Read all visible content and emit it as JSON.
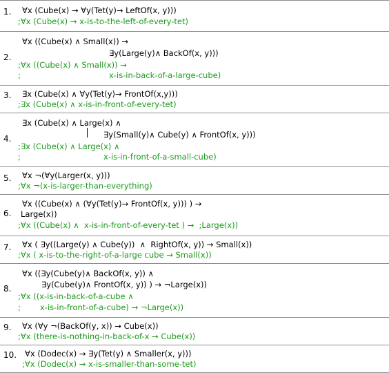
{
  "exercises": [
    {
      "num": "1.",
      "lines": [
        {
          "text": "∀x (Cube(x) → ∀y(Tet(y)→ LeftOf(x, y)))",
          "kind": "fol"
        },
        {
          "text": ";∀x (Cube(x) → x-is-to-the-left-of-every-tet)",
          "kind": "ann"
        }
      ]
    },
    {
      "num": "2.",
      "lines": [
        {
          "text": "∀x ((Cube(x) ∧ Small(x)) →",
          "kind": "fol"
        },
        {
          "text": "∃y(Large(y)∧ BackOf(x, y)))",
          "kind": "fol"
        },
        {
          "text": ";∀x ((Cube(x) ∧ Small(x)) →",
          "kind": "ann"
        },
        {
          "text": ";",
          "kind": "ann"
        },
        {
          "text": "x-is-in-back-of-a-large-cube)",
          "kind": "ann"
        }
      ]
    },
    {
      "num": "3.",
      "lines": [
        {
          "text": "∃x (Cube(x) ∧ ∀y(Tet(y)→ FrontOf(x,y)))",
          "kind": "fol"
        },
        {
          "text": ";∃x (Cube(x) ∧ x-is-in-front-of-every-tet)",
          "kind": "ann"
        }
      ]
    },
    {
      "num": "4.",
      "lines": [
        {
          "text": "∃x (Cube(x) ∧ Large(x) ∧",
          "kind": "fol"
        },
        {
          "text": "∃y(Small(y)∧ Cube(y) ∧ FrontOf(x, y)))",
          "kind": "fol"
        },
        {
          "text": ";∃x (Cube(x) ∧ Large(x) ∧",
          "kind": "ann"
        },
        {
          "text": ";",
          "kind": "ann"
        },
        {
          "text": "x-is-in-front-of-a-small-cube)",
          "kind": "ann"
        }
      ]
    },
    {
      "num": "5.",
      "lines": [
        {
          "text": "∀x ¬(∀y(Larger(x, y)))",
          "kind": "fol"
        },
        {
          "text": ";∀x ¬(x-is-larger-than-everything)",
          "kind": "ann"
        }
      ]
    },
    {
      "num": "6.",
      "lines": [
        {
          "text": "∀x ((Cube(x) ∧ (∀y(Tet(y)→ FrontOf(x, y))) ) →",
          "kind": "fol"
        },
        {
          "text": "Large(x))",
          "kind": "fol"
        },
        {
          "text": ";∀x ((Cube(x) ∧  x-is-in-front-of-every-tet ) →  ;Large(x))",
          "kind": "ann"
        }
      ]
    },
    {
      "num": "7.",
      "lines": [
        {
          "text": "∀x ( ∃y((Large(y) ∧ Cube(y))  ∧  RightOf(x, y)) → Small(x))",
          "kind": "fol"
        },
        {
          "text": ";∀x ( x-is-to-the-right-of-a-large cube → Small(x))",
          "kind": "ann"
        }
      ]
    },
    {
      "num": "8.",
      "lines": [
        {
          "text": "∀x ((∃y(Cube(y)∧ BackOf(x, y)) ∧",
          "kind": "fol"
        },
        {
          "text": "∃y(Cube(y)∧ FrontOf(x, y)) ) → ¬Large(x))",
          "kind": "fol"
        },
        {
          "text": ";∀x ((x-is-in-back-of-a-cube ∧",
          "kind": "ann"
        },
        {
          "text": ";",
          "kind": "ann"
        },
        {
          "text": "x-is-in-front-of-a-cube) → ¬Large(x))",
          "kind": "ann"
        }
      ]
    },
    {
      "num": "9.",
      "lines": [
        {
          "text": "∀x (∀y ¬(BackOf(y, x)) → Cube(x))",
          "kind": "fol"
        },
        {
          "text": ";∀x (there-is-nothing-in-back-of-x → Cube(x))",
          "kind": "ann"
        }
      ]
    },
    {
      "num": "10.",
      "lines": [
        {
          "text": "∀x (Dodec(x) → ∃y(Tet(y) ∧ Smaller(x, y)))",
          "kind": "fol"
        },
        {
          "text": ";∀x (Dodec(x) → x-is-smaller-than-some-tet)",
          "kind": "ann"
        }
      ]
    }
  ]
}
